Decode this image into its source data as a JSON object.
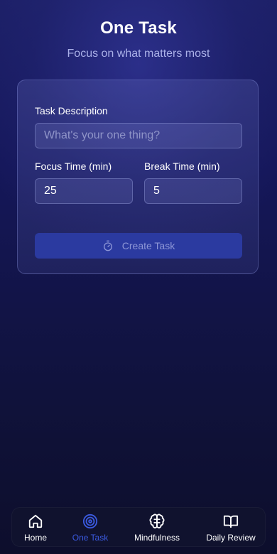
{
  "header": {
    "title": "One Task",
    "subtitle": "Focus on what matters most"
  },
  "form": {
    "task_label": "Task Description",
    "task_placeholder": "What's your one thing?",
    "task_value": "",
    "focus_label": "Focus Time (min)",
    "focus_value": "25",
    "break_label": "Break Time (min)",
    "break_value": "5",
    "create_label": "Create Task",
    "create_icon": "timer-icon"
  },
  "nav": {
    "active": "One Task",
    "items": [
      {
        "label": "Home",
        "icon": "home-icon"
      },
      {
        "label": "One Task",
        "icon": "target-icon"
      },
      {
        "label": "Mindfulness",
        "icon": "brain-icon"
      },
      {
        "label": "Daily Review",
        "icon": "book-open-icon"
      }
    ]
  },
  "colors": {
    "accent": "#3b5ae0",
    "button": "#2b3aa0",
    "background_top": "#1c1f66",
    "background_bottom": "#0d0e2c"
  }
}
